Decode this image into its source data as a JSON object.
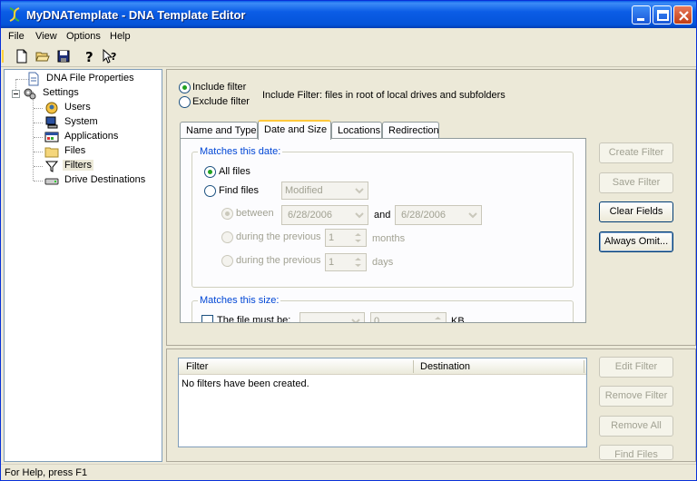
{
  "window": {
    "title": "MyDNATemplate - DNA Template Editor"
  },
  "menu": [
    "File",
    "View",
    "Options",
    "Help"
  ],
  "tree": {
    "items": [
      {
        "label": "DNA File Properties",
        "icon": "file-icon"
      },
      {
        "label": "Settings",
        "icon": "gears-icon"
      },
      {
        "label": "Users",
        "icon": "users-icon"
      },
      {
        "label": "System",
        "icon": "computer-icon"
      },
      {
        "label": "Applications",
        "icon": "applications-icon"
      },
      {
        "label": "Files",
        "icon": "folder-icon"
      },
      {
        "label": "Filters",
        "icon": "funnel-icon",
        "selected": true
      },
      {
        "label": "Drive Destinations",
        "icon": "drive-icon"
      }
    ]
  },
  "filter_mode": {
    "include_label": "Include filter",
    "exclude_label": "Exclude filter",
    "selected": "include",
    "description": "Include Filter: files in root of local drives and subfolders"
  },
  "tabs": [
    "Name and Type",
    "Date and Size",
    "Locations",
    "Redirection"
  ],
  "active_tab": "Date and Size",
  "date_group": {
    "title": "Matches this date:",
    "all_files_label": "All files",
    "find_files_label": "Find files",
    "date_type_value": "Modified",
    "between_label": "between",
    "date_from": "6/28/2006",
    "and_label": "and",
    "date_to": "6/28/2006",
    "previous_label": "during the previous",
    "months_value": "1",
    "months_label": "months",
    "days_value": "1",
    "days_label": "days"
  },
  "size_group": {
    "title": "Matches this size:",
    "must_be_label": "The file must be:",
    "size_value": "0",
    "unit_label": "KB"
  },
  "filter_buttons": {
    "create": "Create Filter",
    "save": "Save Filter",
    "clear": "Clear Fields",
    "always_omit": "Always Omit..."
  },
  "list": {
    "columns": [
      "Filter",
      "Destination"
    ],
    "empty_text": "No filters have been created."
  },
  "list_buttons": {
    "edit": "Edit Filter",
    "remove": "Remove Filter",
    "remove_all": "Remove All",
    "find_files": "Find Files"
  },
  "status": {
    "text": "For Help, press F1"
  }
}
